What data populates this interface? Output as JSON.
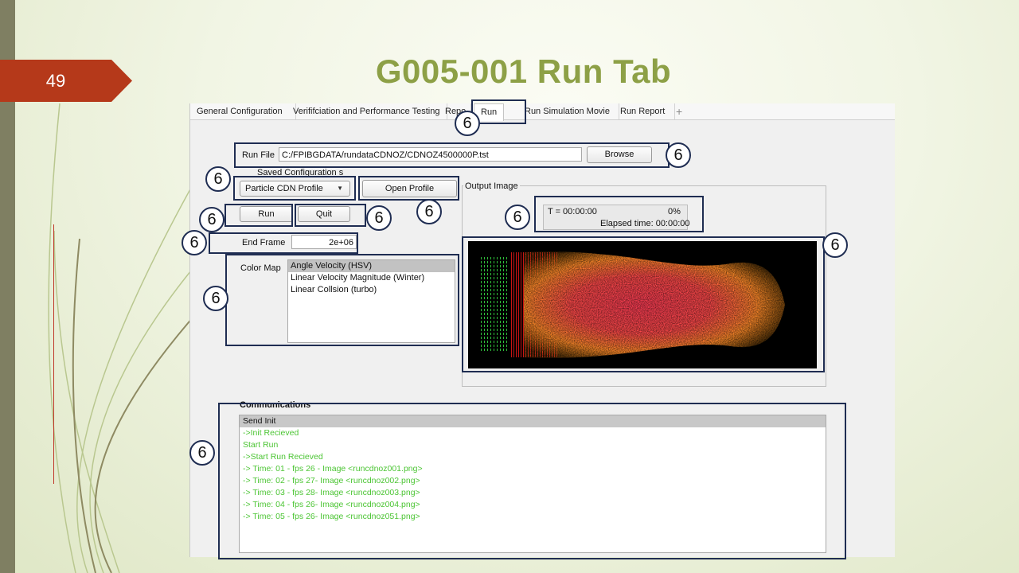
{
  "slide": {
    "number": "49",
    "title": "G005-001 Run Tab",
    "badge_label": "6"
  },
  "tabs": [
    {
      "label": "General Configuration"
    },
    {
      "label": "Verififciation and Performance Testing"
    },
    {
      "label": "Repo"
    },
    {
      "label": "Run"
    },
    {
      "label": "Run Simulation Movie"
    },
    {
      "label": "Run Report"
    }
  ],
  "tab_add_label": "+",
  "run_file": {
    "label": "Run File",
    "value": "C:/FPIBGDATA/rundataCDNOZ/CDNOZ4500000P.tst",
    "browse_label": "Browse"
  },
  "saved_config": {
    "label": "Saved Configuration s",
    "selected": "Particle CDN Profile",
    "open_profile_label": "Open Profile"
  },
  "controls": {
    "run_label": "Run",
    "quit_label": "Quit"
  },
  "end_frame": {
    "label": "End Frame",
    "value": "2e+06"
  },
  "color_map": {
    "label": "Color Map",
    "options": [
      "Angle Velocity  (HSV)",
      "Linear Velocity Magnitude (Winter)",
      "Linear Collsion (turbo)"
    ],
    "selected_index": 0
  },
  "output_image": {
    "label": "Output Image",
    "time_text": "T = 00:00:00",
    "percent_text": "0%",
    "elapsed_text": "Elapsed time: 00:00:00"
  },
  "communications": {
    "label": "Communications",
    "lines": [
      "Send Init",
      "->Init Recieved",
      "Start Run",
      "->Start Run Recieved",
      "-> Time: 01  - fps 26 - Image <runcdnoz001.png>",
      "-> Time: 02 - fps 27- Image <runcdnoz002.png>",
      "-> Time: 03 - fps 28- Image <runcdnoz003.png>",
      "-> Time: 04 - fps 26- Image <runcdnoz004.png>",
      "-> Time: 05  - fps 26- Image <runcdnoz051.png>"
    ]
  },
  "colors": {
    "title": "#8da046",
    "slide_number_bg": "#b5391a",
    "highlight_border": "#1f2d52",
    "comm_text": "#4cc534"
  }
}
